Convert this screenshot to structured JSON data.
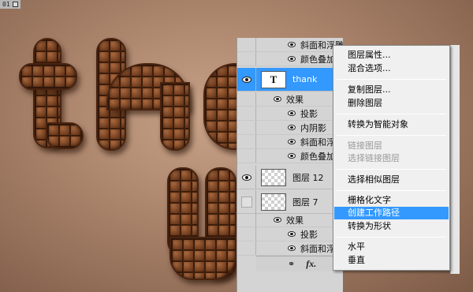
{
  "canvas": {
    "tag": "01",
    "colors": {
      "background": "#a9826a",
      "chocolate": "#6b3b1f",
      "chocolate_dark": "#3d1e0c"
    }
  },
  "layers_panel": {
    "rows": [
      {
        "label": "斜面和浮雕"
      },
      {
        "label": "颜色叠加"
      },
      {
        "label": "thank",
        "thumb_glyph": "T"
      },
      {
        "label": "效果"
      },
      {
        "label": "投影"
      },
      {
        "label": "内阴影"
      },
      {
        "label": "斜面和浮雕"
      },
      {
        "label": "颜色叠加"
      },
      {
        "label": "图层 12"
      },
      {
        "label": "图层 7"
      },
      {
        "label": "效果"
      },
      {
        "label": "投影"
      },
      {
        "label": "斜面和浮雕"
      }
    ],
    "footer": {
      "link_icon": "link-icon",
      "fx_label": "fx."
    },
    "colors": {
      "panel": "#d4d4d4",
      "selected": "#3399ff"
    }
  },
  "context_menu": {
    "items": [
      {
        "label": "图层属性...",
        "state": "normal"
      },
      {
        "label": "混合选项...",
        "state": "normal"
      },
      {
        "label": "复制图层...",
        "state": "normal"
      },
      {
        "label": "删除图层",
        "state": "normal"
      },
      {
        "label": "转换为智能对象",
        "state": "normal"
      },
      {
        "label": "链接图层",
        "state": "disabled"
      },
      {
        "label": "选择链接图层",
        "state": "disabled"
      },
      {
        "label": "选择相似图层",
        "state": "normal"
      },
      {
        "label": "栅格化文字",
        "state": "normal"
      },
      {
        "label": "创建工作路径",
        "state": "highlighted"
      },
      {
        "label": "转换为形状",
        "state": "normal"
      },
      {
        "label": "水平",
        "state": "normal"
      },
      {
        "label": "垂直",
        "state": "normal"
      }
    ],
    "colors": {
      "background": "#f0f0f0",
      "highlight": "#3399ff",
      "disabled_text": "#9a9a9a"
    }
  }
}
